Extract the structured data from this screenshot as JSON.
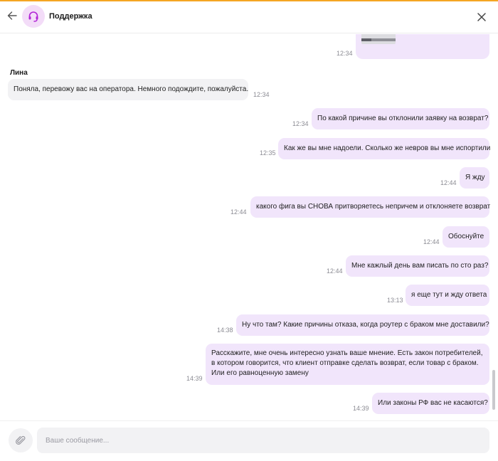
{
  "header": {
    "title": "Поддержка"
  },
  "colors": {
    "accent_top": "#f5a623",
    "outgoing_bubble": "#f1e5fb",
    "incoming_bubble": "#f2f2f4",
    "avatar_bg": "#f3dcf8",
    "avatar_icon": "#b224d6"
  },
  "icons": {
    "back": "arrow-left-icon",
    "avatar": "headset-icon",
    "close": "close-icon",
    "attach": "paperclip-icon"
  },
  "chat": {
    "first_image_time": "12:34",
    "sender_name": "Лина",
    "messages": [
      {
        "dir": "in",
        "text": "Поняла, перевожу вас на оператора. Немного подождите, пожалуйста.",
        "time": "12:34"
      },
      {
        "dir": "out",
        "text": "По какой причине вы отклонили заявку на возврат?",
        "time": "12:34"
      },
      {
        "dir": "out",
        "text": "Как же вы мне надоели. Сколько же невров вы мне испортили",
        "time": "12:35"
      },
      {
        "dir": "out",
        "text": "Я жду",
        "time": "12:44"
      },
      {
        "dir": "out",
        "text": "какого фига вы СНОВА притворяетесь непричем и отклоняете возврат",
        "time": "12:44"
      },
      {
        "dir": "out",
        "text": "Обоснуйте",
        "time": "12:44"
      },
      {
        "dir": "out",
        "text": "Мне кажлый день вам писать по сто раз?",
        "time": "12:44"
      },
      {
        "dir": "out",
        "text": "я еще тут и жду ответа",
        "time": "13:13"
      },
      {
        "dir": "out",
        "text": "Ну что там? Какие причины отказа, когда роутер с браком мне доставили?",
        "time": "14:38"
      },
      {
        "dir": "out",
        "text": "Расскажите, мне очень интересно узнать ваше мнение. Есть закон потребителей, в котором говорится, что клиент отправке сделать возврат, если товар с браком. Или его равноценную замену",
        "time": "14:39"
      },
      {
        "dir": "out",
        "text": "Или законы РФ вас не касаются?",
        "time": "14:39"
      }
    ]
  },
  "composer": {
    "placeholder": "Ваше сообщение..."
  }
}
